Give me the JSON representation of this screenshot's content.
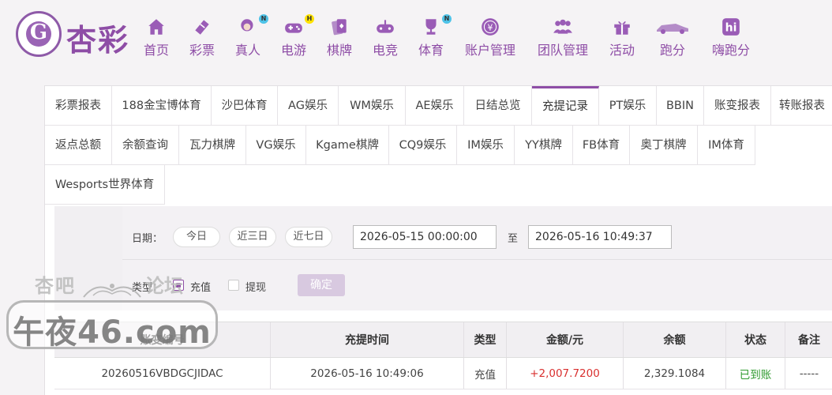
{
  "logo": {
    "text": "杏彩",
    "mark": "G"
  },
  "nav": [
    {
      "label": "首页",
      "icon": "home-icon"
    },
    {
      "label": "彩票",
      "icon": "ticket-icon"
    },
    {
      "label": "真人",
      "icon": "dealer-icon",
      "badge": "N"
    },
    {
      "label": "电游",
      "icon": "gamepad-icon",
      "badge": "H"
    },
    {
      "label": "棋牌",
      "icon": "cards-icon"
    },
    {
      "label": "电竞",
      "icon": "joystick-icon"
    },
    {
      "label": "体育",
      "icon": "trophy-icon",
      "badge": "N"
    },
    {
      "label": "账户管理",
      "icon": "yen-coin-icon"
    },
    {
      "label": "团队管理",
      "icon": "team-icon"
    },
    {
      "label": "活动",
      "icon": "gift-icon"
    },
    {
      "label": "跑分",
      "icon": "car-icon"
    },
    {
      "label": "嗨跑分",
      "icon": "hi-logo-icon",
      "glyph": "hi"
    }
  ],
  "tabs": [
    {
      "label": "彩票报表"
    },
    {
      "label": "188金宝博体育"
    },
    {
      "label": "沙巴体育"
    },
    {
      "label": "AG娱乐"
    },
    {
      "label": "WM娱乐"
    },
    {
      "label": "AE娱乐"
    },
    {
      "label": "日结总览"
    },
    {
      "label": "充提记录",
      "active": true
    },
    {
      "label": "PT娱乐"
    },
    {
      "label": "BBIN"
    },
    {
      "label": "账变报表"
    },
    {
      "label": "转账报表"
    },
    {
      "label": "返点总额"
    },
    {
      "label": "余额查询"
    },
    {
      "label": "瓦力棋牌"
    },
    {
      "label": "VG娱乐"
    },
    {
      "label": "Kgame棋牌"
    },
    {
      "label": "CQ9娱乐"
    },
    {
      "label": "IM娱乐"
    },
    {
      "label": "YY棋牌"
    },
    {
      "label": "FB体育"
    },
    {
      "label": "奥丁棋牌"
    },
    {
      "label": "IM体育"
    },
    {
      "label": "Wesports世界体育"
    }
  ],
  "filter": {
    "date_label": "日期：",
    "quick": [
      "今日",
      "近三日",
      "近七日"
    ],
    "start": "2026-05-15 00:00:00",
    "to": "至",
    "end": "2026-05-16 10:49:37",
    "type_label": "类型：",
    "types": [
      {
        "label": "充值",
        "selected": true
      },
      {
        "label": "提现",
        "selected": false
      }
    ],
    "confirm": "确定"
  },
  "table": {
    "headers": [
      "账变编号",
      "充提时间",
      "类型",
      "金额/元",
      "余额",
      "状态",
      "备注"
    ],
    "rows": [
      [
        "20260516VBDGCJIDAC",
        "2026-05-16 10:49:06",
        "充值",
        "+2,007.7200",
        "2,329.1084",
        "已到账",
        "-----"
      ]
    ]
  },
  "watermark": {
    "line1a": "杏吧",
    "line1b": "论坛",
    "main": "午夜46.com"
  },
  "colors": {
    "brand": "#8e4da6",
    "amount": "#d9302f",
    "status_ok": "#2e9a2e"
  }
}
